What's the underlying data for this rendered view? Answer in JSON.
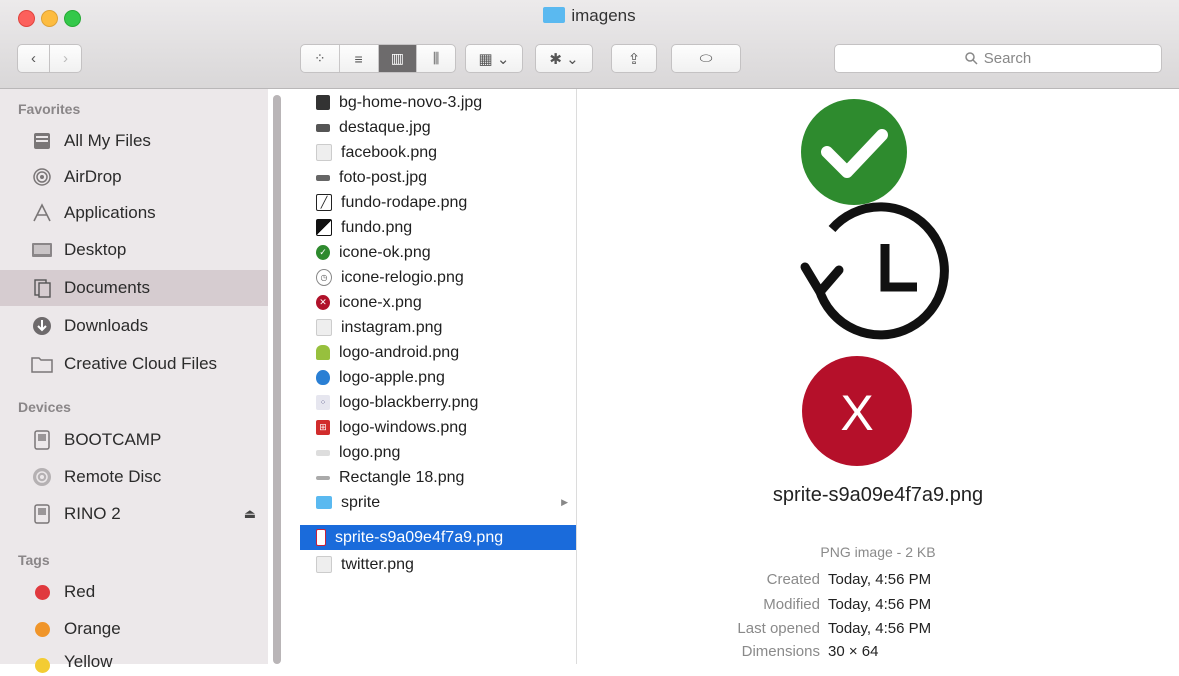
{
  "window": {
    "title": "imagens"
  },
  "toolbar": {
    "back": "‹",
    "forward": "›",
    "view_modes": [
      "⁘",
      "≡",
      "▥",
      "⫼"
    ],
    "arrange_icon": "▦ ⌄",
    "action_icon": "✱ ⌄",
    "share_icon": "⇪",
    "tag_icon": "⬭",
    "search_placeholder": "Search"
  },
  "sidebar": {
    "favorites_header": "Favorites",
    "favorites": [
      {
        "label": "All My Files",
        "icon": "all-files-icon"
      },
      {
        "label": "AirDrop",
        "icon": "airdrop-icon"
      },
      {
        "label": "Applications",
        "icon": "applications-icon"
      },
      {
        "label": "Desktop",
        "icon": "desktop-icon"
      },
      {
        "label": "Documents",
        "icon": "documents-icon"
      },
      {
        "label": "Downloads",
        "icon": "downloads-icon"
      },
      {
        "label": "Creative Cloud Files",
        "icon": "folder-icon"
      }
    ],
    "devices_header": "Devices",
    "devices": [
      {
        "label": "BOOTCAMP",
        "icon": "disk-icon"
      },
      {
        "label": "Remote Disc",
        "icon": "remote-disc-icon"
      },
      {
        "label": "RINO 2",
        "icon": "disk-icon",
        "eject": "⏏"
      }
    ],
    "tags_header": "Tags",
    "tags": [
      {
        "label": "Red",
        "color": "#e0393e"
      },
      {
        "label": "Orange",
        "color": "#f0952a"
      },
      {
        "label": "Yellow",
        "color": "#f3cc33"
      }
    ]
  },
  "files": [
    {
      "name": "bg-home-novo-3.jpg",
      "color": "#333333"
    },
    {
      "name": "destaque.jpg",
      "color": "#555555"
    },
    {
      "name": "facebook.png",
      "color": "#d8d8d8"
    },
    {
      "name": "foto-post.jpg",
      "color": "#666666"
    },
    {
      "name": "fundo-rodape.png",
      "color": "#222222"
    },
    {
      "name": "fundo.png",
      "color": "#111111"
    },
    {
      "name": "icone-ok.png",
      "color": "#2e8a2e"
    },
    {
      "name": "icone-relogio.png",
      "color": "#888888"
    },
    {
      "name": "icone-x.png",
      "color": "#b0122a"
    },
    {
      "name": "instagram.png",
      "color": "#d8d8d8"
    },
    {
      "name": "logo-android.png",
      "color": "#97c03d"
    },
    {
      "name": "logo-apple.png",
      "color": "#2a7fd4"
    },
    {
      "name": "logo-blackberry.png",
      "color": "#5b5b8a"
    },
    {
      "name": "logo-windows.png",
      "color": "#d12c2c"
    },
    {
      "name": "logo.png",
      "color": "#bbbbbb"
    },
    {
      "name": "Rectangle 18.png",
      "color": "#999999"
    },
    {
      "name": "sprite",
      "color": "#5ab9f0",
      "folder": true,
      "arrow": "▶"
    },
    {
      "name": "sprite-s9a09e4f7a9.png",
      "color": "#c8213a",
      "selected": true
    },
    {
      "name": "twitter.png",
      "color": "#d8d8d8"
    }
  ],
  "preview": {
    "filename": "sprite-s9a09e4f7a9.png",
    "kind": "PNG image - 2 KB",
    "meta": [
      {
        "label": "Created",
        "value": "Today, 4:56 PM"
      },
      {
        "label": "Modified",
        "value": "Today, 4:56 PM"
      },
      {
        "label": "Last opened",
        "value": "Today, 4:56 PM"
      },
      {
        "label": "Dimensions",
        "value": "30 × 64"
      }
    ],
    "colors": {
      "ok": "#2e8b2e",
      "x": "#b5102a"
    }
  }
}
